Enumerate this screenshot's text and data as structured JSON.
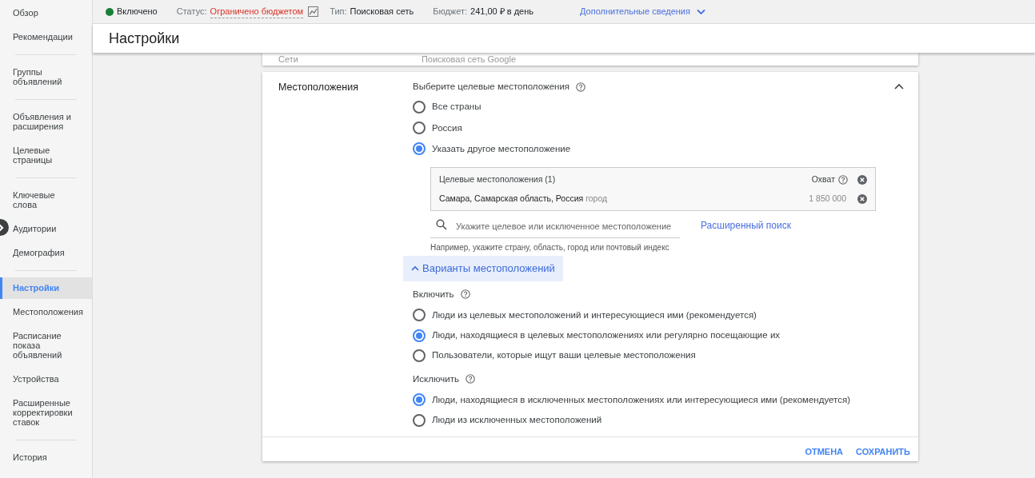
{
  "sidebar": {
    "groups": [
      [
        {
          "label": "Обзор",
          "selected": false
        },
        {
          "label": "Рекомендации",
          "selected": false
        }
      ],
      [
        {
          "label": "Группы объявлений",
          "selected": false
        }
      ],
      [
        {
          "label": "Объявления и расширения",
          "selected": false
        },
        {
          "label": "Целевые страницы",
          "selected": false
        }
      ],
      [
        {
          "label": "Ключевые слова",
          "selected": false
        },
        {
          "label": "Аудитории",
          "selected": false
        },
        {
          "label": "Демография",
          "selected": false
        }
      ],
      [
        {
          "label": "Настройки",
          "selected": true
        },
        {
          "label": "Местоположения",
          "selected": false
        },
        {
          "label": "Расписание показа объявлений",
          "selected": false
        },
        {
          "label": "Устройства",
          "selected": false
        },
        {
          "label": "Расширенные корректировки ставок",
          "selected": false
        }
      ],
      [
        {
          "label": "История",
          "selected": false
        }
      ]
    ]
  },
  "status_bar": {
    "state": {
      "label": "Включено",
      "color": "#188038"
    },
    "status_label": "Статус:",
    "status_value": "Ограничено бюджетом",
    "type_label": "Тип:",
    "type_value": "Поисковая сеть",
    "budget_label": "Бюджет:",
    "budget_value": "241,00 ₽ в день",
    "details_link": "Дополнительные сведения"
  },
  "page_title": "Настройки",
  "networks": {
    "label": "Сети",
    "value": "Поисковая сеть Google"
  },
  "locations": {
    "label": "Местоположения",
    "prompt": "Выберите целевые местоположения",
    "options": [
      {
        "label": "Все страны",
        "selected": false
      },
      {
        "label": "Россия",
        "selected": false
      },
      {
        "label": "Указать другое местоположение",
        "selected": true
      }
    ],
    "targets": {
      "heading": "Целевые местоположения (1)",
      "reach_label": "Охват",
      "rows": [
        {
          "name": "Самара, Самарская область, Россия",
          "type": "город",
          "reach": "1 850 000"
        }
      ]
    },
    "search": {
      "placeholder": "Укажите целевое или исключенное местоположение",
      "hint": "Например, укажите страну, область, город или почтовый индекс",
      "advanced_link": "Расширенный поиск"
    },
    "options_toggle": {
      "label": "Варианты местоположений",
      "expanded": true
    },
    "include": {
      "label": "Включить",
      "options": [
        {
          "label": "Люди из целевых местоположений и интересующиеся ими (рекомендуется)",
          "selected": false
        },
        {
          "label": "Люди, находящиеся в целевых местоположениях или регулярно посещающие их",
          "selected": true
        },
        {
          "label": "Пользователи, которые ищут ваши целевые местоположения",
          "selected": false
        }
      ]
    },
    "exclude": {
      "label": "Исключить",
      "options": [
        {
          "label": "Люди, находящиеся в исключенных местоположениях или интересующиеся ими (рекомендуется)",
          "selected": true
        },
        {
          "label": "Люди из исключенных местоположений",
          "selected": false
        }
      ]
    },
    "buttons": [
      "ОТМЕНА",
      "СОХРАНИТЬ"
    ]
  }
}
